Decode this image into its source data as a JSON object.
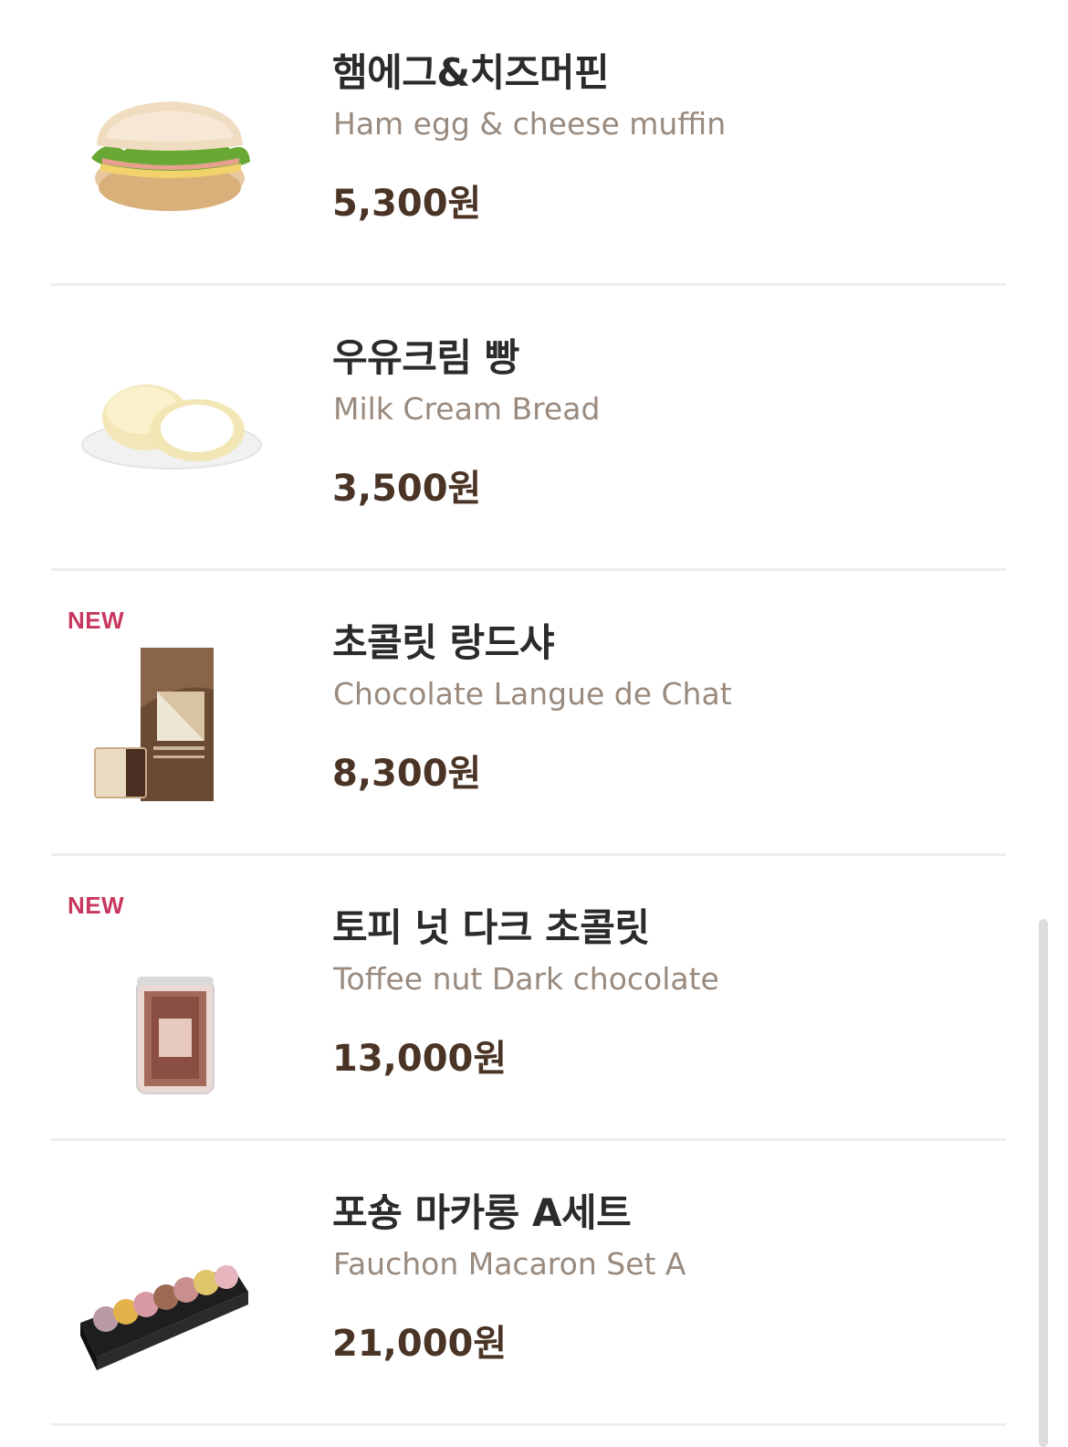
{
  "items": [
    {
      "name": "햄에그&치즈머핀",
      "name_en": "Ham egg & cheese muffin",
      "price": "5,300원",
      "badge": "",
      "image_icon": "muffin-image"
    },
    {
      "name": "우유크림 빵",
      "name_en": "Milk Cream Bread",
      "price": "3,500원",
      "badge": "",
      "image_icon": "cream-bread-image"
    },
    {
      "name": "초콜릿 랑드샤",
      "name_en": "Chocolate Langue de Chat",
      "price": "8,300원",
      "badge": "NEW",
      "image_icon": "langue-de-chat-box-image"
    },
    {
      "name": "토피 넛 다크 초콜릿",
      "name_en": "Toffee nut Dark chocolate",
      "price": "13,000원",
      "badge": "NEW",
      "image_icon": "toffee-nut-jar-image"
    },
    {
      "name": "포숑 마카롱 A세트",
      "name_en": "Fauchon Macaron Set A",
      "price": "21,000원",
      "badge": "",
      "image_icon": "macaron-box-image"
    }
  ],
  "colors": {
    "badge": "#c8385e",
    "price": "#4a3426",
    "subtitle": "#9a8a7e",
    "title": "#2b2b2b"
  }
}
